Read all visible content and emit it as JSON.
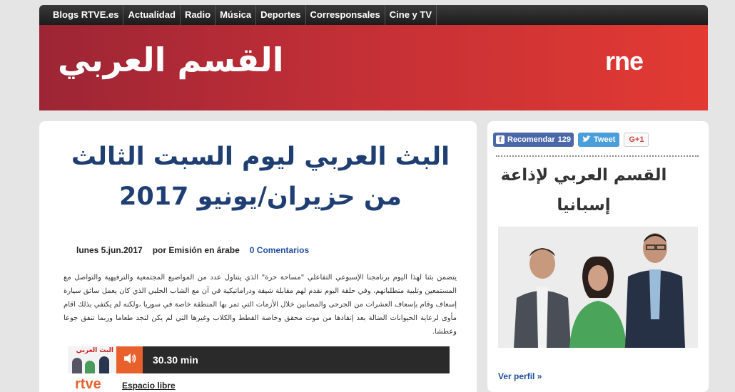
{
  "nav": {
    "items": [
      {
        "label": "Blogs RTVE.es"
      },
      {
        "label": "Actualidad"
      },
      {
        "label": "Radio"
      },
      {
        "label": "Música"
      },
      {
        "label": "Deportes"
      },
      {
        "label": "Corresponsales"
      },
      {
        "label": "Cine y TV"
      }
    ]
  },
  "banner": {
    "title": "القسم العربي",
    "logo": "rne"
  },
  "post": {
    "title": "البث العربي ليوم السبت الثالث من حزيران/يونيو 2017",
    "date": "lunes 5.jun.2017",
    "author": "por Emisión en árabe",
    "comments": "0 Comentarios",
    "excerpt": "يتضمن بثنا لهذا اليوم برنامجنا الإسبوعي التفاعلي \"مساحة حرة\" الذي يتناول عدد من المواضيع المجتمعية والترفيهية والتواصل مع المستمعين وتلبية متطلباتهم، وفي حلقة اليوم نقدم لهم مقابلة شيقة ودراماتيكية في آن مع الشاب الحلبي الذي كان يعمل سائق سيارة إسعاف وقام بإسعاف العشرات من الجرحى والمصابين خلال الأزمات التي تمر بها المنطقة خاصة في سوريا ،ولكنه لم يكتفي بذلك اقام مأوى لرعاية الحيوانات الضالة بعد إنقاذها من موت محقق وخاصة القطط والكلاب وغيرها التي لم يكن لتجد طعاما وربما تنفق جوعا وعطشا."
  },
  "player": {
    "thumb_label": "البث العربي",
    "duration": "30.30 min",
    "brand": "rtve",
    "program": "Espacio libre",
    "accent": "#e8612c"
  },
  "sidebar": {
    "share": {
      "facebook_label": "Recomendar",
      "facebook_count": "129",
      "twitter_label": "Tweet",
      "gplus_label": "G+1"
    },
    "title": "القسم العربي لإذاعة إسبانيا",
    "profile_link": "Ver perfil »"
  },
  "colors": {
    "nav_bg": "#1c1c1c",
    "banner_start": "#9c2535",
    "banner_end": "#e33a33",
    "title_blue": "#1f3f73",
    "link_blue": "#1f4e9c"
  }
}
